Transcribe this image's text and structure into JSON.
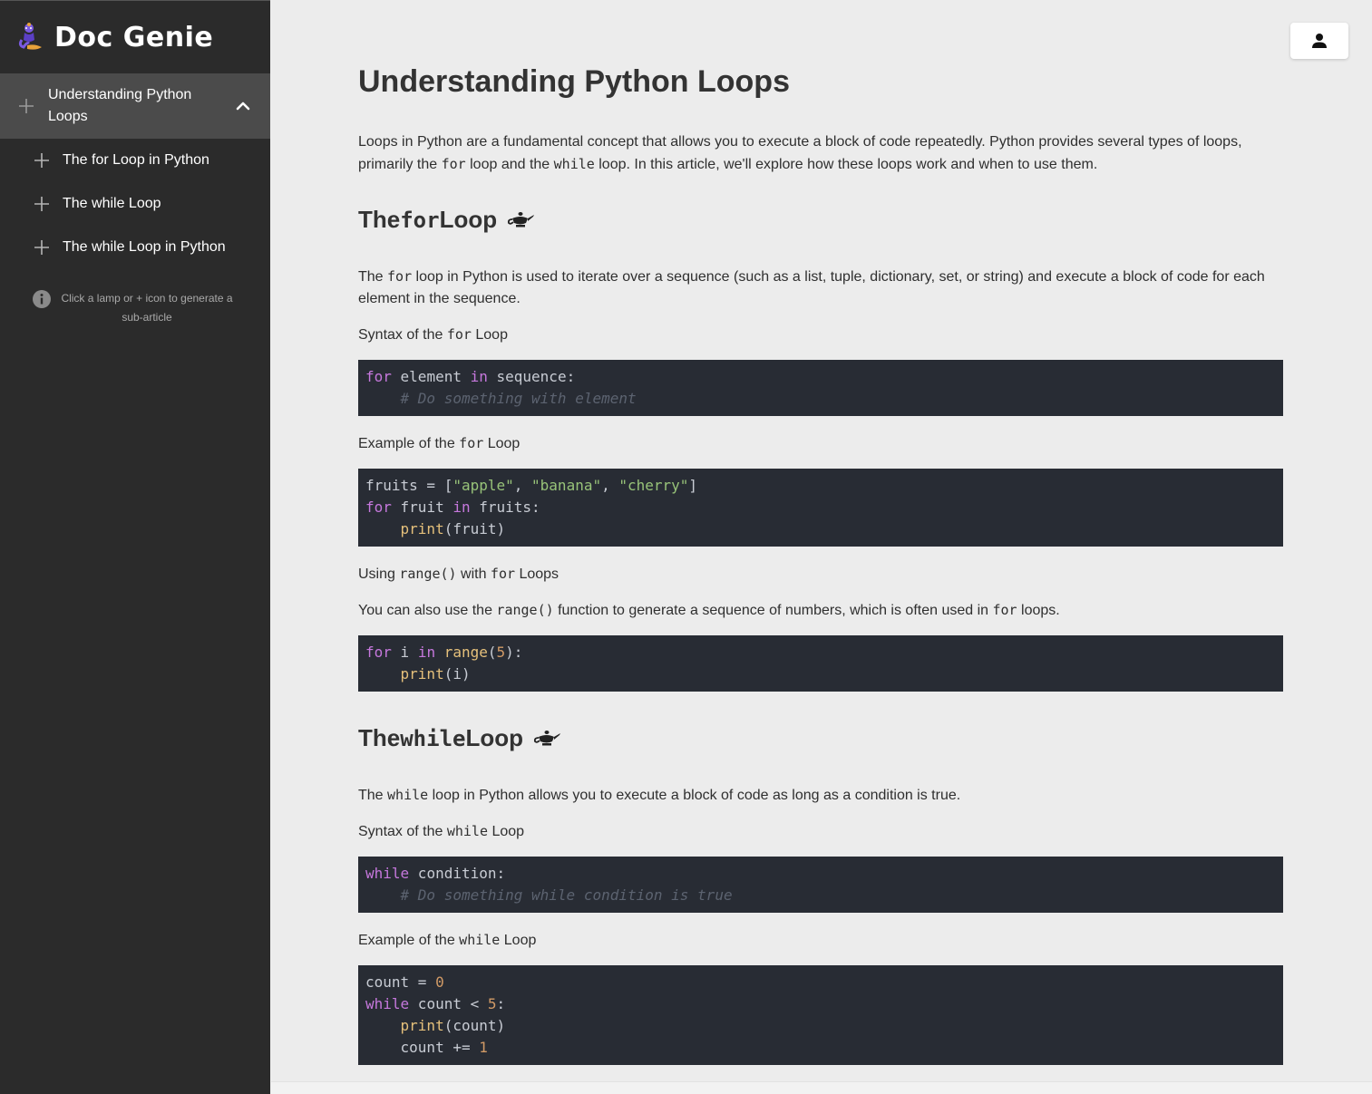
{
  "app": {
    "name": "Doc Genie"
  },
  "sidebar": {
    "current_article": "Understanding Python Loops",
    "items": [
      {
        "label": "The for Loop in Python"
      },
      {
        "label": "The while Loop"
      },
      {
        "label": "The while Loop in Python"
      }
    ],
    "hint": "Click a lamp or + icon to generate a sub-article"
  },
  "article": {
    "title": "Understanding Python Loops",
    "intro": {
      "t1": "Loops in Python are a fundamental concept that allows you to execute a block of code repeatedly. Python provides several types of loops, primarily the ",
      "c1": "for",
      "t2": " loop and the ",
      "c2": "while",
      "t3": " loop. In this article, we'll explore how these loops work and when to use them."
    },
    "for_section": {
      "heading_pre": "The ",
      "heading_code": "for",
      "heading_post": " Loop",
      "desc": {
        "t1": "The ",
        "c1": "for",
        "t2": " loop in Python is used to iterate over a sequence (such as a list, tuple, dictionary, set, or string) and execute a block of code for each element in the sequence."
      },
      "syntax_label": {
        "t1": "Syntax of the ",
        "c1": "for",
        "t2": " Loop"
      },
      "syntax_code": {
        "k1": "for",
        "a1": " element ",
        "k2": "in",
        "a2": " sequence:",
        "indent": "    ",
        "comment": "# Do something with element"
      },
      "example_label": {
        "t1": "Example of the ",
        "c1": "for",
        "t2": " Loop"
      },
      "example_code": {
        "l1a": "fruits = [",
        "s1": "\"apple\"",
        "l1b": ", ",
        "s2": "\"banana\"",
        "l1c": ", ",
        "s3": "\"cherry\"",
        "l1d": "]",
        "k1": "for",
        "l2a": " fruit ",
        "k2": "in",
        "l2b": " fruits:",
        "indent": "    ",
        "f1": "print",
        "l3": "(fruit)"
      },
      "range_label": {
        "t1": "Using ",
        "c1": "range()",
        "t2": " with ",
        "c2": "for",
        "t3": " Loops"
      },
      "range_desc": {
        "t1": "You can also use the ",
        "c1": "range()",
        "t2": " function to generate a sequence of numbers, which is often used in ",
        "c2": "for",
        "t3": " loops."
      },
      "range_code": {
        "k1": "for",
        "a1": " i ",
        "k2": "in",
        "sp": " ",
        "f1": "range",
        "a2": "(",
        "n1": "5",
        "a3": "):",
        "indent": "    ",
        "f2": "print",
        "a4": "(i)"
      }
    },
    "while_section": {
      "heading_pre": "The ",
      "heading_code": "while",
      "heading_post": " Loop",
      "desc": {
        "t1": "The ",
        "c1": "while",
        "t2": " loop in Python allows you to execute a block of code as long as a condition is true."
      },
      "syntax_label": {
        "t1": "Syntax of the ",
        "c1": "while",
        "t2": " Loop"
      },
      "syntax_code": {
        "k1": "while",
        "a1": " condition:",
        "indent": "    ",
        "comment": "# Do something while condition is true"
      },
      "example_label": {
        "t1": "Example of the ",
        "c1": "while",
        "t2": " Loop"
      },
      "example_code": {
        "l1a": "count = ",
        "n1": "0",
        "k1": "while",
        "l2a": " count < ",
        "n2": "5",
        "l2b": ":",
        "indent": "    ",
        "f1": "print",
        "l3": "(count)",
        "l4a": "count += ",
        "n3": "1"
      }
    }
  },
  "colors": {
    "sidebar_bg": "#2b2b2b",
    "sidebar_active": "#4b4b4b",
    "content_bg": "#ececec",
    "code_bg": "#282c34",
    "keyword": "#c678dd",
    "string": "#98c379",
    "function": "#e5c07b",
    "number": "#d19a66",
    "comment": "#5c6370"
  },
  "icons": {
    "brand": "genie-icon",
    "plus": "plus-icon",
    "collapse": "chevron-up-icon",
    "info": "info-icon",
    "lamp": "lamp-icon",
    "account": "user-icon"
  }
}
